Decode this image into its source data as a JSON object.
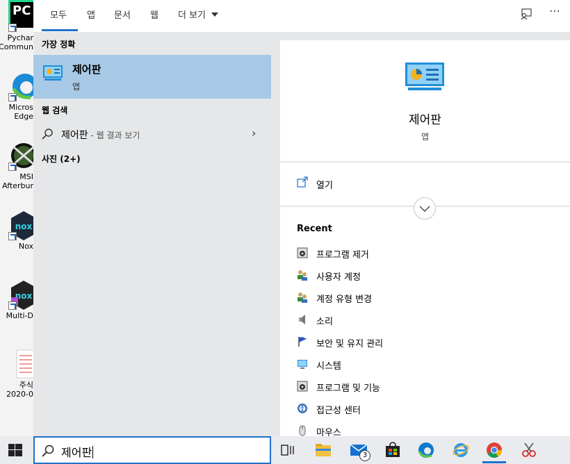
{
  "desktop": {
    "icons": [
      {
        "label": "Pychar\nCommun",
        "name": "pycharm"
      },
      {
        "label": "Micros\nEdge",
        "name": "edge"
      },
      {
        "label": "MSI\nAfterbur",
        "name": "msi"
      },
      {
        "label": "Nox",
        "name": "nox"
      },
      {
        "label": "Multi-D",
        "name": "multidrive"
      },
      {
        "label": "주식\n2020-0",
        "name": "file"
      }
    ]
  },
  "tabs": {
    "all": "모두",
    "apps": "앱",
    "docs": "문서",
    "web": "웹",
    "more": "더 보기"
  },
  "left": {
    "best_match_header": "가장 정확",
    "best_title": "제어판",
    "best_sub": "앱",
    "web_header": "웹 검색",
    "web_query": "제어판",
    "web_suffix": " - 웹 결과 보기",
    "photos_header": "사진 (2+)"
  },
  "right": {
    "title": "제어판",
    "sub": "앱",
    "open_label": "열기",
    "recent_header": "Recent",
    "recent": [
      {
        "label": "프로그램 제거",
        "icon": "programs-icon"
      },
      {
        "label": "사용자 계정",
        "icon": "users-icon"
      },
      {
        "label": "계정 유형 변경",
        "icon": "users-icon"
      },
      {
        "label": "소리",
        "icon": "speaker-icon"
      },
      {
        "label": "보안 및 유지 관리",
        "icon": "flag-icon"
      },
      {
        "label": "시스템",
        "icon": "monitor-icon"
      },
      {
        "label": "프로그램 및 기능",
        "icon": "programs-icon"
      },
      {
        "label": "접근성 센터",
        "icon": "accessibility-icon"
      },
      {
        "label": "마우스",
        "icon": "mouse-icon"
      }
    ]
  },
  "search": {
    "value": "제어판"
  },
  "taskbar": {
    "mail_badge": "3"
  },
  "colors": {
    "accent": "#2270c9",
    "selected": "#a7c9e6"
  }
}
